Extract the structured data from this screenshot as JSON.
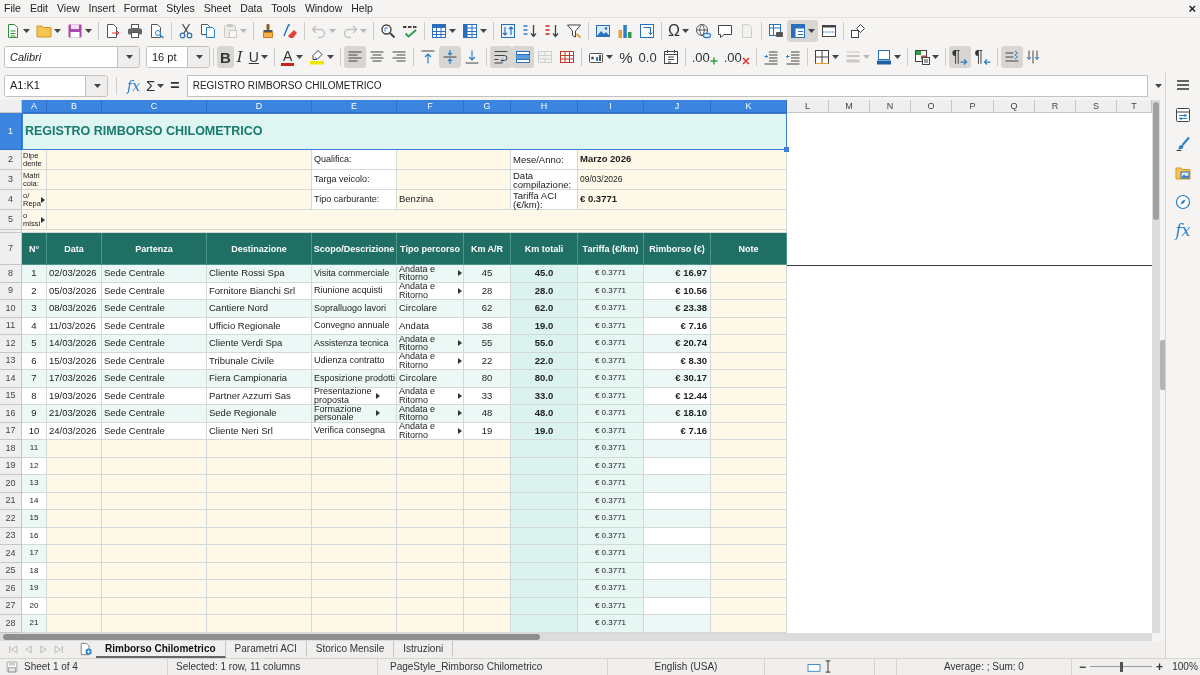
{
  "menu_bar": {
    "items": [
      "File",
      "Edit",
      "View",
      "Insert",
      "Format",
      "Styles",
      "Sheet",
      "Data",
      "Tools",
      "Window",
      "Help"
    ],
    "close": "×"
  },
  "standard_toolbar": [
    [
      {
        "kind": "new",
        "pressed": false,
        "disabled": false
      },
      {
        "kind": "open",
        "pressed": false,
        "disabled": false
      },
      {
        "kind": "save",
        "pressed": false,
        "disabled": false
      }
    ],
    [
      {
        "kind": "export_pdf",
        "pressed": false,
        "disabled": false
      },
      {
        "kind": "print",
        "pressed": false,
        "disabled": false
      },
      {
        "kind": "print_preview",
        "pressed": false,
        "disabled": false
      }
    ],
    [
      {
        "kind": "cut",
        "pressed": false,
        "disabled": false
      },
      {
        "kind": "copy",
        "pressed": false,
        "disabled": false
      },
      {
        "kind": "paste",
        "pressed": false,
        "disabled": true
      }
    ],
    [
      {
        "kind": "clone_formatting",
        "pressed": false,
        "disabled": false
      },
      {
        "kind": "clear_formatting",
        "pressed": false,
        "disabled": false
      }
    ],
    [
      {
        "kind": "undo",
        "pressed": false,
        "disabled": true
      },
      {
        "kind": "redo",
        "pressed": false,
        "disabled": true
      }
    ],
    [
      {
        "kind": "find_replace",
        "pressed": false,
        "disabled": false
      },
      {
        "kind": "spelling",
        "pressed": false,
        "disabled": false
      }
    ],
    [
      {
        "kind": "insert_row",
        "pressed": false,
        "disabled": false
      },
      {
        "kind": "insert_column",
        "pressed": false,
        "disabled": false
      }
    ],
    [
      {
        "kind": "sort",
        "pressed": false,
        "disabled": false
      },
      {
        "kind": "sort_ascending",
        "pressed": false,
        "disabled": false
      },
      {
        "kind": "sort_descending",
        "pressed": false,
        "disabled": false
      },
      {
        "kind": "autofilter",
        "pressed": false,
        "disabled": false
      }
    ],
    [
      {
        "kind": "image",
        "pressed": false,
        "disabled": false
      },
      {
        "kind": "chart",
        "pressed": false,
        "disabled": false
      },
      {
        "kind": "pivot_table",
        "pressed": false,
        "disabled": false
      }
    ],
    [
      {
        "kind": "special_character",
        "label": "Ω",
        "pressed": false,
        "disabled": false
      },
      {
        "kind": "hyperlink",
        "pressed": false,
        "disabled": false
      },
      {
        "kind": "comment",
        "pressed": false,
        "disabled": false
      },
      {
        "kind": "header_footer",
        "pressed": false,
        "disabled": true
      }
    ],
    [
      {
        "kind": "print_area",
        "pressed": false,
        "disabled": false
      },
      {
        "kind": "freeze",
        "pressed": true,
        "disabled": false
      },
      {
        "kind": "split_window",
        "pressed": false,
        "disabled": false
      }
    ],
    [
      {
        "kind": "shapes",
        "pressed": false,
        "disabled": false
      }
    ]
  ],
  "formatting_toolbar": {
    "font_name": "Calibri",
    "font_size": "16 pt",
    "groups": [
      [
        {
          "kind": "bold",
          "label": "B",
          "pressed": true,
          "disabled": false
        },
        {
          "kind": "italic",
          "label": "I",
          "pressed": false,
          "disabled": false
        },
        {
          "kind": "underline",
          "label": "U",
          "pressed": false,
          "disabled": false
        }
      ],
      [
        {
          "kind": "font_color",
          "label": "A",
          "pressed": false,
          "disabled": false
        },
        {
          "kind": "highlight",
          "pressed": false,
          "disabled": false
        }
      ],
      [
        {
          "kind": "align_left",
          "pressed": true,
          "disabled": false
        },
        {
          "kind": "align_center",
          "pressed": false,
          "disabled": false
        },
        {
          "kind": "align_right",
          "pressed": false,
          "disabled": false
        }
      ],
      [
        {
          "kind": "align_top",
          "pressed": false,
          "disabled": false
        },
        {
          "kind": "align_middle",
          "pressed": true,
          "disabled": false
        },
        {
          "kind": "align_bottom",
          "pressed": false,
          "disabled": false
        }
      ],
      [
        {
          "kind": "wrap_text",
          "pressed": true,
          "disabled": false
        },
        {
          "kind": "merge_center",
          "pressed": true,
          "disabled": false
        },
        {
          "kind": "merge_cells",
          "pressed": false,
          "disabled": true
        },
        {
          "kind": "unmerge_cells",
          "pressed": false,
          "disabled": false
        }
      ],
      [
        {
          "kind": "currency",
          "pressed": false,
          "disabled": false
        },
        {
          "kind": "percent",
          "label": "%",
          "pressed": false,
          "disabled": false
        },
        {
          "kind": "number",
          "label": "0.0",
          "pressed": false,
          "disabled": false
        },
        {
          "kind": "date",
          "pressed": false,
          "disabled": false
        }
      ],
      [
        {
          "kind": "add_decimal",
          "label": ".00",
          "pressed": false,
          "disabled": false
        },
        {
          "kind": "delete_decimal",
          "label": ".00",
          "pressed": false,
          "disabled": false
        }
      ],
      [
        {
          "kind": "indent_increase",
          "pressed": false,
          "disabled": false
        },
        {
          "kind": "indent_decrease",
          "pressed": false,
          "disabled": false
        }
      ],
      [
        {
          "kind": "borders",
          "pressed": false,
          "disabled": false
        },
        {
          "kind": "border_style",
          "pressed": false,
          "disabled": true
        },
        {
          "kind": "border_color",
          "pressed": false,
          "disabled": false
        }
      ],
      [
        {
          "kind": "conditional",
          "pressed": false,
          "disabled": false
        }
      ],
      [
        {
          "kind": "paragraph_ltr",
          "label": "¶",
          "pressed": true,
          "disabled": false
        },
        {
          "kind": "paragraph_rtl",
          "label": "¶",
          "pressed": false,
          "disabled": false
        }
      ],
      [
        {
          "kind": "text_ltr",
          "pressed": true,
          "disabled": false
        },
        {
          "kind": "text_ttb",
          "pressed": false,
          "disabled": false
        }
      ]
    ]
  },
  "formula_bar": {
    "name_box": "A1:K1",
    "buttons": [
      {
        "kind": "function_wizard",
        "label": "fx"
      },
      {
        "kind": "sum",
        "label": "Σ"
      },
      {
        "kind": "formula",
        "label": "="
      }
    ],
    "content": "REGISTRO RIMBORSO CHILOMETRICO"
  },
  "sidebar": [
    {
      "kind": "properties",
      "selected": false
    },
    {
      "kind": "styles",
      "selected": false
    },
    {
      "kind": "gallery",
      "selected": false
    },
    {
      "kind": "navigator",
      "selected": false
    },
    {
      "kind": "functions",
      "label": "fx",
      "selected": false
    }
  ],
  "sheet": {
    "columns": [
      {
        "label": "A",
        "selected": true
      },
      {
        "label": "B",
        "selected": true
      },
      {
        "label": "C",
        "selected": true
      },
      {
        "label": "D",
        "selected": true
      },
      {
        "label": "E",
        "selected": true
      },
      {
        "label": "F",
        "selected": true
      },
      {
        "label": "G",
        "selected": true
      },
      {
        "label": "H",
        "selected": true
      },
      {
        "label": "I",
        "selected": true
      },
      {
        "label": "J",
        "selected": true
      },
      {
        "label": "K",
        "selected": true
      },
      {
        "label": "L",
        "selected": false
      },
      {
        "label": "M",
        "selected": false
      },
      {
        "label": "N",
        "selected": false
      },
      {
        "label": "O",
        "selected": false
      },
      {
        "label": "P",
        "selected": false
      },
      {
        "label": "Q",
        "selected": false
      },
      {
        "label": "R",
        "selected": false
      },
      {
        "label": "S",
        "selected": false
      },
      {
        "label": "T",
        "selected": false
      }
    ],
    "row_headers": [
      {
        "label": "1",
        "selected": true
      },
      {
        "label": "2",
        "selected": false
      },
      {
        "label": "3",
        "selected": false
      },
      {
        "label": "4",
        "selected": false
      },
      {
        "label": "5",
        "selected": false
      },
      {
        "selected": false
      },
      {
        "label": "7",
        "selected": false
      },
      {
        "label": "8",
        "selected": false
      },
      {
        "label": "9",
        "selected": false
      },
      {
        "label": "10",
        "selected": false
      },
      {
        "label": "11",
        "selected": false
      },
      {
        "label": "12",
        "selected": false
      },
      {
        "label": "13",
        "selected": false
      },
      {
        "label": "14",
        "selected": false
      },
      {
        "label": "15",
        "selected": false
      },
      {
        "label": "16",
        "selected": false
      },
      {
        "label": "17",
        "selected": false
      },
      {
        "label": "18",
        "selected": false
      },
      {
        "label": "19",
        "selected": false
      },
      {
        "label": "20",
        "selected": false
      },
      {
        "label": "21",
        "selected": false
      },
      {
        "label": "22",
        "selected": false
      },
      {
        "label": "23",
        "selected": false
      },
      {
        "label": "24",
        "selected": false
      },
      {
        "label": "25",
        "selected": false
      },
      {
        "label": "26",
        "selected": false
      },
      {
        "label": "27",
        "selected": false
      },
      {
        "label": "28",
        "selected": false
      }
    ],
    "title": "REGISTRO RIMBORSO CHILOMETRICO",
    "title_selected": true,
    "info_rows": [
      {
        "kind": "details",
        "label": "Dipe dente",
        "label_clipped": false,
        "field_label": "Qualifica:",
        "meta_label": "Mese/Anno:",
        "meta_value": "Marzo 2026",
        "meta_value_bold": true
      },
      {
        "kind": "details",
        "label": "Matri cola:",
        "label_clipped": false,
        "field_label": "Targa veicolo:",
        "meta_label": "Data compilazione:",
        "meta_value": "09/03/2026",
        "meta_value_bold": false
      },
      {
        "kind": "details",
        "label": "o/ Repa",
        "label_clipped": true,
        "field_label": "Tipo carburante:",
        "field_value": "Benzina",
        "meta_label": "Tariffa ACI (€/km):",
        "meta_value": "€ 0.3771",
        "meta_value_bold": true
      },
      {
        "kind": "wide",
        "label": "o missi",
        "label_clipped": true
      }
    ],
    "table": {
      "headers": [
        "N°",
        "Data",
        "Partenza",
        "Destinazione",
        "Scopo/Descrizione",
        "Tipo percorso",
        "Km A/R",
        "Km totali",
        "Tariffa (€/km)",
        "Rimborso (€)",
        "Note"
      ],
      "rows": [
        {
          "n": "1",
          "date": "02/03/2026",
          "from": "Sede Centrale",
          "to": "Cliente Rossi Spa",
          "purpose": "Visita commerciale",
          "purpose_clipped": false,
          "route": "Andata e Ritorno",
          "route_clipped": true,
          "km_ar": "45",
          "km_total": "45.0",
          "rate": "€ 0.3771",
          "refund": "€ 16.97"
        },
        {
          "n": "2",
          "date": "05/03/2026",
          "from": "Sede Centrale",
          "to": "Fornitore Bianchi Srl",
          "purpose": "Riunione acquisti",
          "purpose_clipped": false,
          "route": "Andata e Ritorno",
          "route_clipped": true,
          "km_ar": "28",
          "km_total": "28.0",
          "rate": "€ 0.3771",
          "refund": "€ 10.56"
        },
        {
          "n": "3",
          "date": "08/03/2026",
          "from": "Sede Centrale",
          "to": "Cantiere Nord",
          "purpose": "Sopralluogo lavori",
          "purpose_clipped": false,
          "route": "Circolare",
          "route_clipped": false,
          "km_ar": "62",
          "km_total": "62.0",
          "rate": "€ 0.3771",
          "refund": "€ 23.38"
        },
        {
          "n": "4",
          "date": "11/03/2026",
          "from": "Sede Centrale",
          "to": "Ufficio Regionale",
          "purpose": "Convegno annuale",
          "purpose_clipped": false,
          "route": "Andata",
          "route_clipped": false,
          "km_ar": "38",
          "km_total": "19.0",
          "rate": "€ 0.3771",
          "refund": "€ 7.16"
        },
        {
          "n": "5",
          "date": "14/03/2026",
          "from": "Sede Centrale",
          "to": "Cliente Verdi Spa",
          "purpose": "Assistenza tecnica",
          "purpose_clipped": false,
          "route": "Andata e Ritorno",
          "route_clipped": true,
          "km_ar": "55",
          "km_total": "55.0",
          "rate": "€ 0.3771",
          "refund": "€ 20.74"
        },
        {
          "n": "6",
          "date": "15/03/2026",
          "from": "Sede Centrale",
          "to": "Tribunale Civile",
          "purpose": "Udienza contratto",
          "purpose_clipped": false,
          "route": "Andata e Ritorno",
          "route_clipped": true,
          "km_ar": "22",
          "km_total": "22.0",
          "rate": "€ 0.3771",
          "refund": "€ 8.30"
        },
        {
          "n": "7",
          "date": "17/03/2026",
          "from": "Sede Centrale",
          "to": "Fiera Campionaria",
          "purpose": "Esposizione prodotti",
          "purpose_clipped": false,
          "route": "Circolare",
          "route_clipped": false,
          "km_ar": "80",
          "km_total": "80.0",
          "rate": "€ 0.3771",
          "refund": "€ 30.17"
        },
        {
          "n": "8",
          "date": "19/03/2026",
          "from": "Sede Centrale",
          "to": "Partner Azzurri Sas",
          "purpose": "Presentazione proposta",
          "purpose_clipped": true,
          "route": "Andata e Ritorno",
          "route_clipped": true,
          "km_ar": "33",
          "km_total": "33.0",
          "rate": "€ 0.3771",
          "refund": "€ 12.44"
        },
        {
          "n": "9",
          "date": "21/03/2026",
          "from": "Sede Centrale",
          "to": "Sede Regionale",
          "purpose": "Formazione personale",
          "purpose_clipped": true,
          "route": "Andata e Ritorno",
          "route_clipped": true,
          "km_ar": "48",
          "km_total": "48.0",
          "rate": "€ 0.3771",
          "refund": "€ 18.10"
        },
        {
          "n": "10",
          "date": "24/03/2026",
          "from": "Sede Centrale",
          "to": "Cliente Neri Srl",
          "purpose": "Verifica consegna",
          "purpose_clipped": false,
          "route": "Andata e Ritorno",
          "route_clipped": true,
          "km_ar": "19",
          "km_total": "19.0",
          "rate": "€ 0.3771",
          "refund": "€ 7.16"
        }
      ],
      "blank_rows": [
        {
          "n": "11",
          "rate": "€ 0.3771"
        },
        {
          "n": "12",
          "rate": "€ 0.3771"
        },
        {
          "n": "13",
          "rate": "€ 0.3771"
        },
        {
          "n": "14",
          "rate": "€ 0.3771"
        },
        {
          "n": "15",
          "rate": "€ 0.3771"
        },
        {
          "n": "16",
          "rate": "€ 0.3771"
        },
        {
          "n": "17",
          "rate": "€ 0.3771"
        },
        {
          "n": "18",
          "rate": "€ 0.3771"
        },
        {
          "n": "19",
          "rate": "€ 0.3771"
        },
        {
          "n": "20",
          "rate": "€ 0.3771"
        },
        {
          "n": "21",
          "rate": "€ 0.3771"
        }
      ]
    }
  },
  "sheet_tab_bar": {
    "navigation": [
      {
        "kind": "first",
        "disabled": true
      },
      {
        "kind": "previous",
        "disabled": true
      },
      {
        "kind": "next",
        "disabled": true
      },
      {
        "kind": "last",
        "disabled": true
      }
    ],
    "tabs": [
      {
        "label": "Rimborso Chilometrico",
        "selected": true
      },
      {
        "label": "Parametri ACI",
        "selected": false
      },
      {
        "label": "Storico Mensile",
        "selected": false
      },
      {
        "label": "Istruzioni",
        "selected": false
      }
    ]
  },
  "status_bar": {
    "sheet": "Sheet 1 of 4",
    "selection": "Selected: 1 row, 11 columns",
    "page_style": "PageStyle_Rimborso Chilometrico",
    "language": "English (USA)",
    "summary": "Average: ; Sum: 0",
    "zoom_out": "−",
    "zoom_in": "+",
    "zoom": {
      "level": 0.5,
      "reading": "100%"
    }
  }
}
